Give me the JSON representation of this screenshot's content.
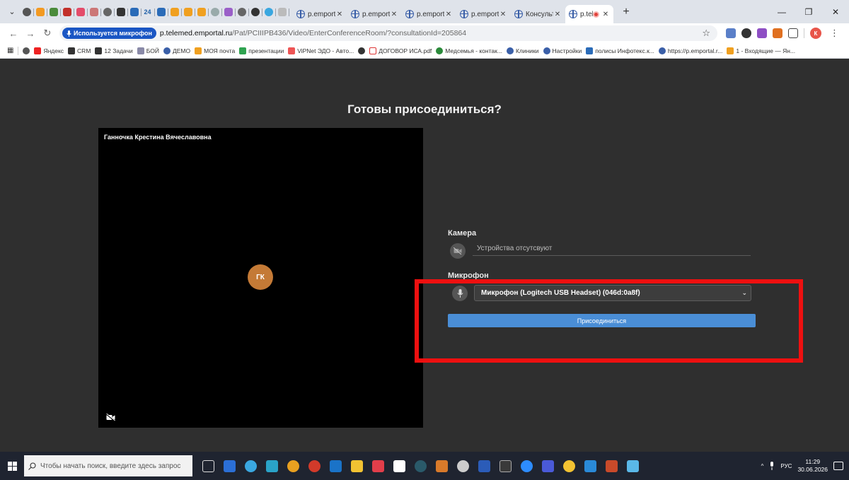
{
  "browser": {
    "tabs": [
      {
        "title": "p.emporta",
        "active": false
      },
      {
        "title": "p.emporta",
        "active": false
      },
      {
        "title": "p.emporta",
        "active": false
      },
      {
        "title": "p.emporta",
        "active": false
      },
      {
        "title": "Консульт",
        "active": false
      },
      {
        "title": "p.tele",
        "active": true
      }
    ],
    "pinned_tab_count": 19,
    "pinned_24_label": "24",
    "address": {
      "mic_indicator": "Используется микрофон",
      "host": "p.telemed.emportal.ru",
      "path": "/Pat/PCIIIPB436/Video/EnterConferenceRoom/?consultationId=205864"
    },
    "profile_initial": "К",
    "bookmarks": [
      "Яндекс",
      "CRM",
      "12 Задачи",
      "БОЙ",
      "ДЕМО",
      "МОЯ почта",
      "презентации",
      "ViPNet ЭДО - Авто...",
      "ДОГОВОР ИСА.pdf",
      "Медсемья - контак...",
      "Клиники",
      "Настройки",
      "полисы Инфотекс.к...",
      "https://p.emportal.r...",
      "1 - Входящие — Ян..."
    ]
  },
  "page": {
    "title": "Готовы присоединиться?",
    "participant_name": "Ганночка Крестина Вячеславовна",
    "avatar_initials": "ГК",
    "camera_label": "Камера",
    "camera_value": "Устройства отсутсвуют",
    "mic_label": "Микрофон",
    "mic_value": "Микрофон (Logitech USB Headset) (046d:0a8f)",
    "join_button": "Присоединиться"
  },
  "taskbar": {
    "search_placeholder": "Чтобы начать поиск, введите здесь запрос",
    "lang": "РУС",
    "time": "11:29",
    "date": "30.06.2026"
  },
  "colors": {
    "page_bg": "#2f2f2f",
    "join_button": "#4a8ed6",
    "highlight_box": "#ee1010",
    "avatar": "#c47a36"
  }
}
